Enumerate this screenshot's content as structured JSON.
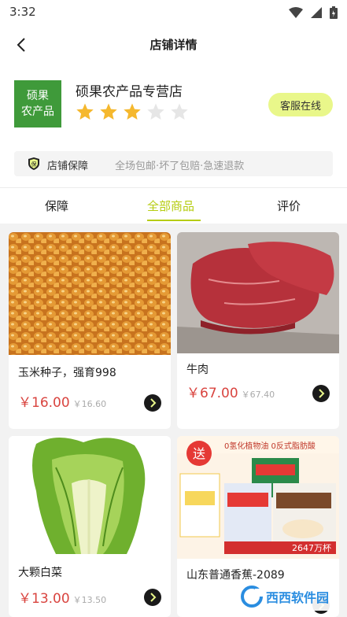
{
  "status_bar": {
    "time": "3:32"
  },
  "nav": {
    "title": "店铺详情"
  },
  "store": {
    "logo_line1": "硕果",
    "logo_line2": "农产品",
    "name": "硕果农产品专营店",
    "rating": 3,
    "rating_max": 5,
    "service_label": "客服在线",
    "colors": {
      "logo_bg": "#3f9a3a",
      "star_on": "#f5b82e",
      "star_off": "#e6e6e6",
      "accent": "#e9f78a"
    }
  },
  "guarantee": {
    "icon": "shield-badge-icon",
    "label": "店铺保障",
    "description": "全场包邮·坏了包赔·急速退款"
  },
  "tabs": [
    {
      "label": "保障",
      "active": false
    },
    {
      "label": "全部商品",
      "active": true
    },
    {
      "label": "评价",
      "active": false
    }
  ],
  "products": [
    {
      "name": "玉米种子，强育998",
      "price": "￥16.00",
      "old_price": "￥16.60",
      "image": "corn-kernels"
    },
    {
      "name": "牛肉",
      "price": "￥67.00",
      "old_price": "￥67.40",
      "image": "beef"
    },
    {
      "name": "大颗白菜",
      "price": "￥13.00",
      "old_price": "￥13.50",
      "image": "napa-cabbage"
    },
    {
      "name": "山东普通香蕉-2089",
      "image": "coffee-ad"
    }
  ],
  "ad": {
    "badge": "送",
    "line1": "0氢化植物油 0反式脂肪酸",
    "count": "2647万杯"
  },
  "watermark": {
    "text": "西西软件园"
  },
  "theme": {
    "price_color": "#d9443f",
    "active_tab": "#b6cc12"
  }
}
